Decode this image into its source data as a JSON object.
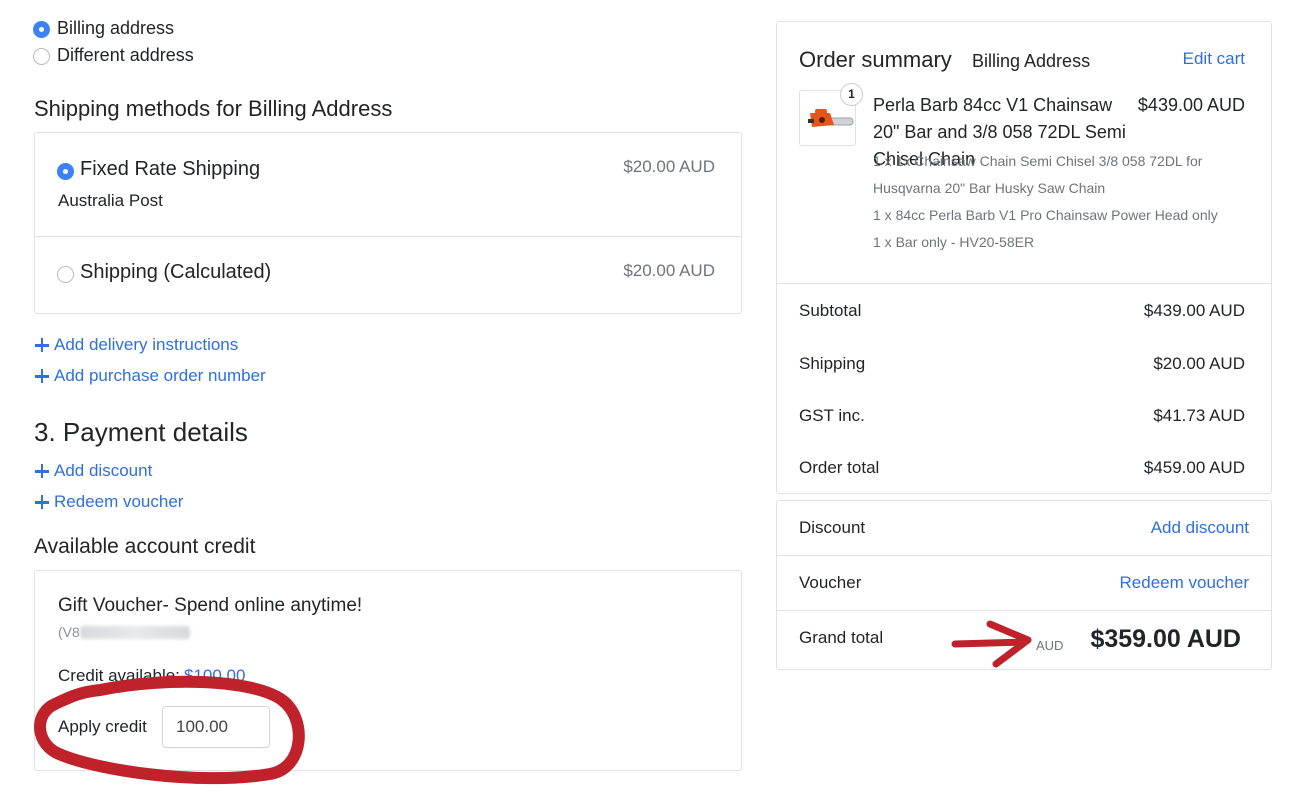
{
  "address_options": [
    {
      "label": "Billing address",
      "selected": true
    },
    {
      "label": "Different address",
      "selected": false
    }
  ],
  "shipping": {
    "heading": "Shipping methods for Billing Address",
    "methods": [
      {
        "label": "Fixed Rate Shipping",
        "sub": "Australia Post",
        "price": "$20.00 AUD",
        "selected": true
      },
      {
        "label": "Shipping (Calculated)",
        "sub": "",
        "price": "$20.00 AUD",
        "selected": false
      }
    ]
  },
  "links": {
    "delivery_instructions": "Add delivery instructions",
    "purchase_order": "Add purchase order number"
  },
  "payment": {
    "heading": "3. Payment details",
    "add_discount": "Add discount",
    "redeem_voucher": "Redeem voucher",
    "credit_heading": "Available account credit",
    "voucher_title": "Gift Voucher- Spend online anytime!",
    "voucher_code": "(V8",
    "credit_available_label": "Credit available:",
    "credit_available_value": "$100.00",
    "apply_credit_label": "Apply credit",
    "apply_credit_value": "100.00"
  },
  "summary": {
    "title": "Order summary",
    "subtitle": "Billing Address",
    "edit_cart": "Edit cart",
    "item": {
      "qty_badge": "1",
      "name": "Perla Barb 84cc V1 Chainsaw 20\" Bar and 3/8 058 72DL Semi Chisel Chain",
      "price": "$439.00 AUD",
      "details": [
        "1 x 1x Chainsaw Chain Semi Chisel 3/8 058 72DL for Husqvarna 20\" Bar Husky Saw Chain",
        "1 x 84cc Perla Barb V1 Pro Chainsaw Power Head only",
        "1 x Bar only - HV20-58ER"
      ]
    },
    "totals": [
      {
        "label": "Subtotal",
        "value": "$439.00 AUD"
      },
      {
        "label": "Shipping",
        "value": "$20.00 AUD"
      },
      {
        "label": "GST inc.",
        "value": "$41.73 AUD"
      },
      {
        "label": "Order total",
        "value": "$459.00 AUD"
      }
    ],
    "discount_label": "Discount",
    "discount_link": "Add discount",
    "voucher_label": "Voucher",
    "voucher_link": "Redeem voucher",
    "grand_total_label": "Grand total",
    "grand_total_currency": "AUD",
    "grand_total_value": "$359.00 AUD"
  },
  "colors": {
    "link": "#2f6fe0",
    "radio_selected": "#3b82f6",
    "annotation": "#c0222b"
  }
}
